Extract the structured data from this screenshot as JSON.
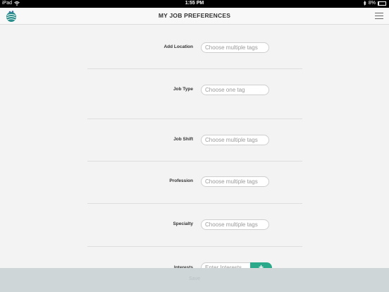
{
  "status_bar": {
    "device": "iPad",
    "time": "1:55 PM",
    "battery": "8%"
  },
  "nav": {
    "title": "MY JOB PREFERENCES",
    "logo_icon": "globe-logo-icon",
    "menu_icon": "hamburger-menu-icon"
  },
  "form": {
    "fields": [
      {
        "label": "Add Location",
        "placeholder": "Choose multiple tags"
      },
      {
        "label": "Job Type",
        "placeholder": "Choose one tag"
      },
      {
        "label": "Job Shift",
        "placeholder": "Choose multiple tags"
      },
      {
        "label": "Profession",
        "placeholder": "Choose multiple tags"
      },
      {
        "label": "Specialty",
        "placeholder": "Choose multiple tags"
      }
    ],
    "interests": {
      "label": "Interests",
      "placeholder": "Enter Interests",
      "add_button": "+"
    }
  },
  "footer": {
    "save_label": "Save"
  },
  "colors": {
    "accent": "#2aaa8a",
    "background": "#f3f3f3",
    "save_bar": "#cfd6d8"
  }
}
